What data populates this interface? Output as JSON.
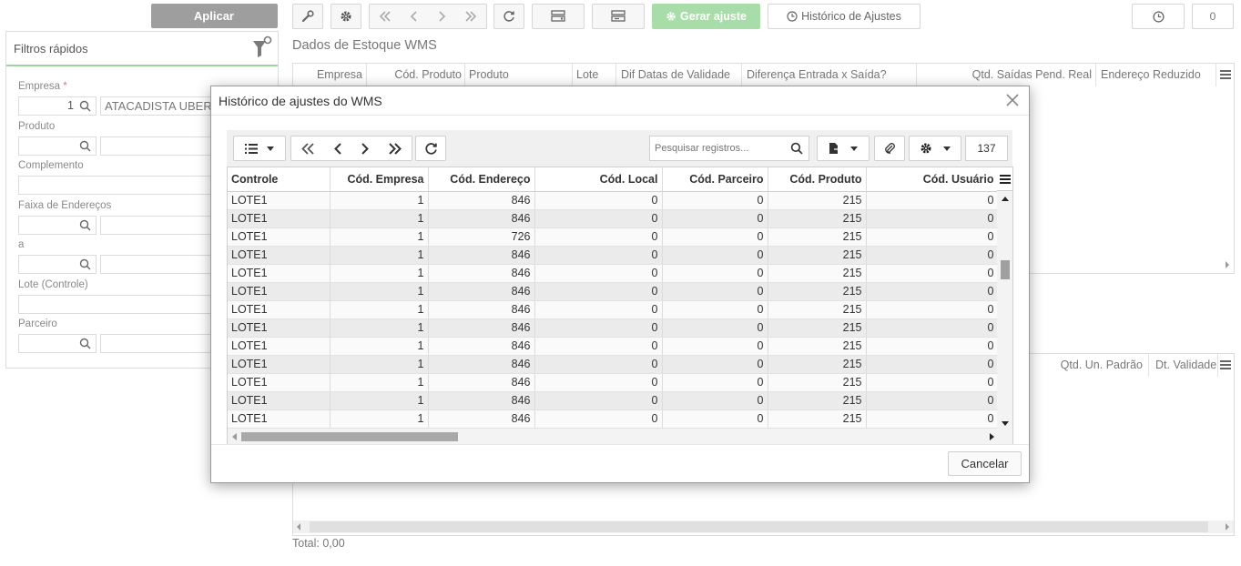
{
  "filters": {
    "apply_label": "Aplicar",
    "title": "Filtros rápidos",
    "empresa_label": "Empresa",
    "required_mark": "*",
    "empresa_code": "1",
    "empresa_name": "ATACADISTA UBER",
    "produto_label": "Produto",
    "complemento_label": "Complemento",
    "faixa_label": "Faixa de Endereços",
    "a_label": "a",
    "lote_label": "Lote (Controle)",
    "parceiro_label": "Parceiro"
  },
  "toolbar": {
    "gerar_label": "Gerar ajuste",
    "historico_label": "Histórico de Ajustes",
    "counter": "0"
  },
  "main": {
    "section_title": "Dados de Estoque WMS",
    "grid1_headers": [
      "Empresa",
      "Cód. Produto",
      "Produto",
      "Lote",
      "Dif Datas de Validade",
      "Diferença Entrada x Saída?",
      "Qtd. Saídas Pend. Real",
      "Endereço Reduzido"
    ],
    "grid2_headers": [
      "Qtd. Un. Padrão",
      "Dt. Validade"
    ],
    "total": "Total: 0,00"
  },
  "modal": {
    "title": "Histórico de ajustes do WMS",
    "search_placeholder": "Pesquisar registros...",
    "record_count": "137",
    "cancel_label": "Cancelar",
    "columns": [
      "Controle",
      "Cód. Empresa",
      "Cód. Endereço",
      "Cód. Local",
      "Cód. Parceiro",
      "Cód. Produto",
      "Cód. Usuário"
    ],
    "rows": [
      [
        "LOTE1",
        "1",
        "846",
        "0",
        "0",
        "215",
        "0"
      ],
      [
        "LOTE1",
        "1",
        "846",
        "0",
        "0",
        "215",
        "0"
      ],
      [
        "LOTE1",
        "1",
        "726",
        "0",
        "0",
        "215",
        "0"
      ],
      [
        "LOTE1",
        "1",
        "846",
        "0",
        "0",
        "215",
        "0"
      ],
      [
        "LOTE1",
        "1",
        "846",
        "0",
        "0",
        "215",
        "0"
      ],
      [
        "LOTE1",
        "1",
        "846",
        "0",
        "0",
        "215",
        "0"
      ],
      [
        "LOTE1",
        "1",
        "846",
        "0",
        "0",
        "215",
        "0"
      ],
      [
        "LOTE1",
        "1",
        "846",
        "0",
        "0",
        "215",
        "0"
      ],
      [
        "LOTE1",
        "1",
        "846",
        "0",
        "0",
        "215",
        "0"
      ],
      [
        "LOTE1",
        "1",
        "846",
        "0",
        "0",
        "215",
        "0"
      ],
      [
        "LOTE1",
        "1",
        "846",
        "0",
        "0",
        "215",
        "0"
      ],
      [
        "LOTE1",
        "1",
        "846",
        "0",
        "0",
        "215",
        "0"
      ],
      [
        "LOTE1",
        "1",
        "846",
        "0",
        "0",
        "215",
        "0"
      ]
    ]
  },
  "colors": {
    "accent_green": "#a8dca8",
    "apply_gray": "#9e9e9e",
    "row_alt": "#ebebeb"
  }
}
